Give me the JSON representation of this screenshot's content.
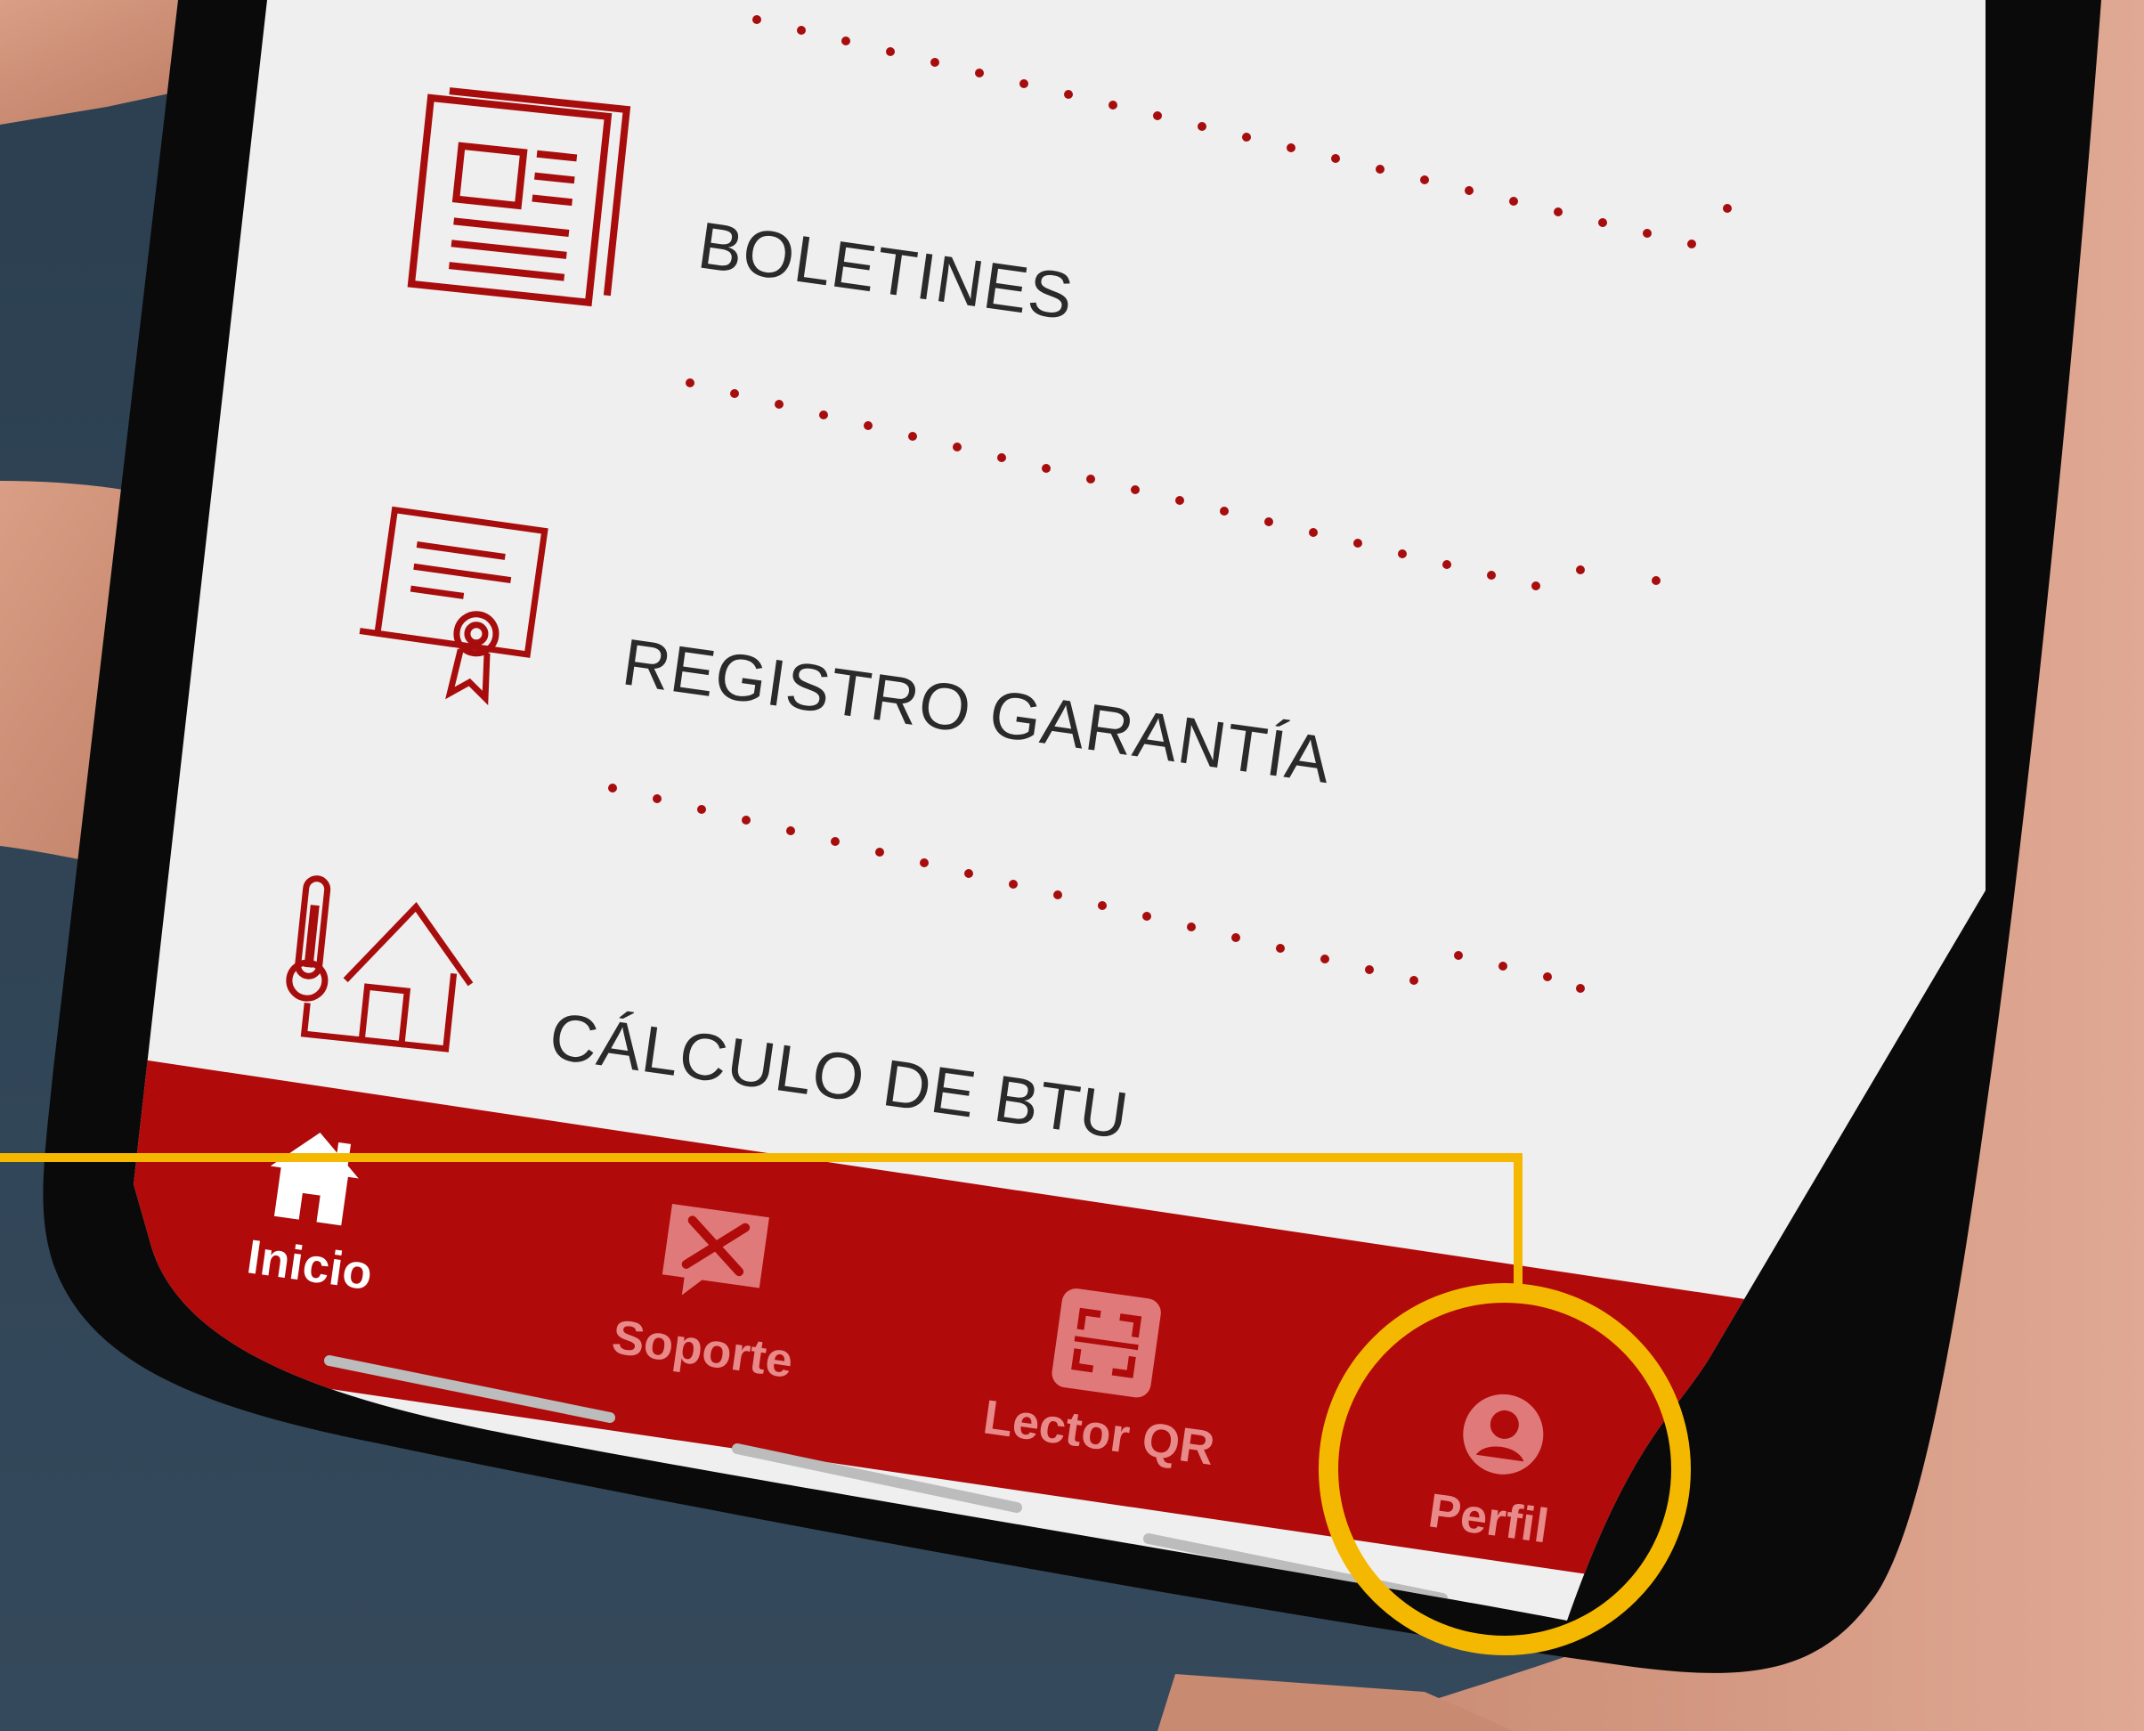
{
  "menu": {
    "items": [
      {
        "label": "BOLETINES",
        "icon": "newspaper-icon"
      },
      {
        "label": "REGISTRO GARANTÍA",
        "icon": "certificate-icon"
      },
      {
        "label": "CÁLCULO DE BTU",
        "icon": "house-thermometer-icon"
      }
    ]
  },
  "bottom_nav": {
    "items": [
      {
        "label": "Inicio",
        "icon": "home-icon",
        "active": true
      },
      {
        "label": "Soporte",
        "icon": "support-tools-icon",
        "active": false
      },
      {
        "label": "Lector QR",
        "icon": "qr-scan-icon",
        "active": false
      },
      {
        "label": "Perfil",
        "icon": "user-profile-icon",
        "active": false
      }
    ]
  },
  "colors": {
    "brand_red": "#a80d0d",
    "nav_bar": "#b00a0a",
    "highlight": "#f5b800",
    "screen_bg": "#efefef",
    "text": "#2a2a2a"
  }
}
